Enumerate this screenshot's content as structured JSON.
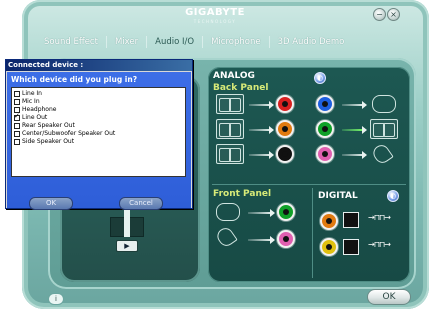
{
  "app": {
    "brand": "GIGABYTE",
    "brand_sub": "TECHNOLOGY"
  },
  "tabs": [
    {
      "label": "Sound Effect"
    },
    {
      "label": "Mixer"
    },
    {
      "label": "Audio I/O"
    },
    {
      "label": "Microphone"
    },
    {
      "label": "3D Audio Demo"
    }
  ],
  "analog": {
    "title": "ANALOG",
    "back_panel_label": "Back Panel",
    "front_panel_label": "Front Panel"
  },
  "digital": {
    "title": "DIGITAL"
  },
  "dialog": {
    "title": "Connected device :",
    "question": "Which device did you plug in?",
    "options": [
      {
        "label": "Line In",
        "checked": false
      },
      {
        "label": "Mic In",
        "checked": false
      },
      {
        "label": "Headphone",
        "checked": false
      },
      {
        "label": "Line Out",
        "checked": true
      },
      {
        "label": "Rear Speaker Out",
        "checked": false
      },
      {
        "label": "Center/Subwoofer Speaker Out",
        "checked": false
      },
      {
        "label": "Side Speaker Out",
        "checked": false
      }
    ],
    "ok_label": "OK",
    "cancel_label": "Cancel"
  },
  "footer": {
    "ok_label": "OK"
  },
  "colors": {
    "jack_red": "#d82020",
    "jack_blue": "#1e5fe0",
    "jack_green": "#10a028",
    "jack_pink": "#e05fb0",
    "jack_black": "#111111",
    "jack_orange": "#e07a10",
    "jack_yellow": "#e0c010",
    "analog_sub": "#d7ea78"
  },
  "icons": {
    "minimize": "minimize-icon",
    "close": "close-icon",
    "globe": "globe-icon",
    "play": "play-icon",
    "digital_optical": "optical-icon",
    "digital_coax": "coax-icon"
  }
}
